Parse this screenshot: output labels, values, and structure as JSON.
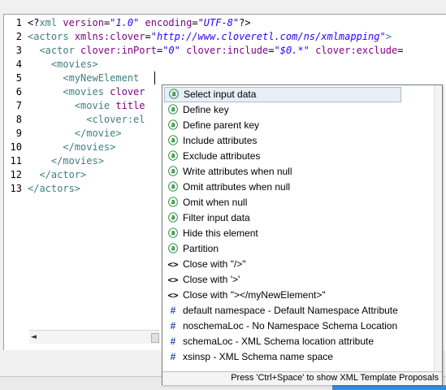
{
  "editor": {
    "lines": [
      {
        "n": "1",
        "parts": [
          [
            "t-pl",
            "<?"
          ],
          [
            "t-el",
            "xml "
          ],
          [
            "t-at",
            "version"
          ],
          [
            "t-pl",
            "="
          ],
          [
            "t-val",
            "\"1.0\""
          ],
          [
            "t-pl",
            " "
          ],
          [
            "t-at",
            "encoding"
          ],
          [
            "t-pl",
            "="
          ],
          [
            "t-val",
            "\"UTF-8\""
          ],
          [
            "t-pl",
            "?>"
          ]
        ]
      },
      {
        "n": "2",
        "parts": [
          [
            "t-el",
            "<actors "
          ],
          [
            "t-at",
            "xmlns:clover"
          ],
          [
            "t-pl",
            "="
          ],
          [
            "t-val",
            "\"http://www.cloveretl.com/ns/xmlmapping\""
          ],
          [
            "t-el",
            ">"
          ]
        ]
      },
      {
        "n": "3",
        "parts": [
          [
            "t-el",
            "  <actor "
          ],
          [
            "t-at",
            "clover:inPort"
          ],
          [
            "t-pl",
            "="
          ],
          [
            "t-val",
            "\"0\""
          ],
          [
            "t-pl",
            " "
          ],
          [
            "t-at",
            "clover:include"
          ],
          [
            "t-pl",
            "="
          ],
          [
            "t-val",
            "\"$0.*\""
          ],
          [
            "t-pl",
            " "
          ],
          [
            "t-at",
            "clover:exclude"
          ],
          [
            "t-pl",
            "="
          ]
        ]
      },
      {
        "n": "4",
        "parts": [
          [
            "t-el",
            "    <movies>"
          ]
        ]
      },
      {
        "n": "5",
        "parts": [
          [
            "t-el",
            "      <myNewElement "
          ]
        ]
      },
      {
        "n": "6",
        "parts": [
          [
            "t-el",
            "      <movies "
          ],
          [
            "t-at",
            "clover"
          ]
        ]
      },
      {
        "n": "7",
        "parts": [
          [
            "t-el",
            "        <movie "
          ],
          [
            "t-at",
            "title"
          ]
        ]
      },
      {
        "n": "8",
        "parts": [
          [
            "t-el",
            "          <clover:el"
          ]
        ]
      },
      {
        "n": "9",
        "parts": [
          [
            "t-el",
            "        </movie>"
          ]
        ]
      },
      {
        "n": "10",
        "parts": [
          [
            "t-el",
            "      </movies>"
          ]
        ]
      },
      {
        "n": "11",
        "parts": [
          [
            "t-el",
            "    </movies>"
          ]
        ]
      },
      {
        "n": "12",
        "parts": [
          [
            "t-el",
            "  </actor>"
          ]
        ]
      },
      {
        "n": "13",
        "parts": [
          [
            "t-el",
            "</actors>"
          ]
        ]
      }
    ]
  },
  "popup": {
    "items": [
      {
        "icon": "at-icon",
        "glyph": "ⓐ",
        "kind": "ic-at",
        "label": "Select input data",
        "selected": true
      },
      {
        "icon": "at-icon",
        "glyph": "ⓐ",
        "kind": "ic-at",
        "label": "Define key"
      },
      {
        "icon": "at-icon",
        "glyph": "ⓐ",
        "kind": "ic-at",
        "label": "Define parent key"
      },
      {
        "icon": "at-icon",
        "glyph": "ⓐ",
        "kind": "ic-at",
        "label": "Include attributes"
      },
      {
        "icon": "at-icon",
        "glyph": "ⓐ",
        "kind": "ic-at",
        "label": "Exclude attributes"
      },
      {
        "icon": "at-icon",
        "glyph": "ⓐ",
        "kind": "ic-at",
        "label": "Write attributes when null"
      },
      {
        "icon": "at-icon",
        "glyph": "ⓐ",
        "kind": "ic-at",
        "label": "Omit attributes when null"
      },
      {
        "icon": "at-icon",
        "glyph": "ⓐ",
        "kind": "ic-at",
        "label": "Omit when null"
      },
      {
        "icon": "at-icon",
        "glyph": "ⓐ",
        "kind": "ic-at",
        "label": "Filter input data"
      },
      {
        "icon": "at-icon",
        "glyph": "ⓐ",
        "kind": "ic-at",
        "label": "Hide this element"
      },
      {
        "icon": "at-icon",
        "glyph": "ⓐ",
        "kind": "ic-at",
        "label": "Partition"
      },
      {
        "icon": "tag-icon",
        "glyph": "<>",
        "kind": "ic-tag",
        "label": "Close with  \"/>\""
      },
      {
        "icon": "tag-icon",
        "glyph": "<>",
        "kind": "ic-tag",
        "label": "Close with  '>'"
      },
      {
        "icon": "tag-icon",
        "glyph": "<>",
        "kind": "ic-tag",
        "label": "Close with \"></myNewElement>\""
      },
      {
        "icon": "hash-icon",
        "glyph": "#",
        "kind": "ic-hash",
        "label": "default namespace - Default Namespace Attribute"
      },
      {
        "icon": "hash-icon",
        "glyph": "#",
        "kind": "ic-hash",
        "label": "noschemaLoc - No Namespace Schema Location"
      },
      {
        "icon": "hash-icon",
        "glyph": "#",
        "kind": "ic-hash",
        "label": "schemaLoc - XML Schema location attribute"
      },
      {
        "icon": "hash-icon",
        "glyph": "#",
        "kind": "ic-hash",
        "label": "xsinsp - XML Schema name space"
      }
    ],
    "footer": "Press 'Ctrl+Space' to show XML Template Proposals"
  },
  "scrollbar": {
    "left_arrow": "◄"
  }
}
